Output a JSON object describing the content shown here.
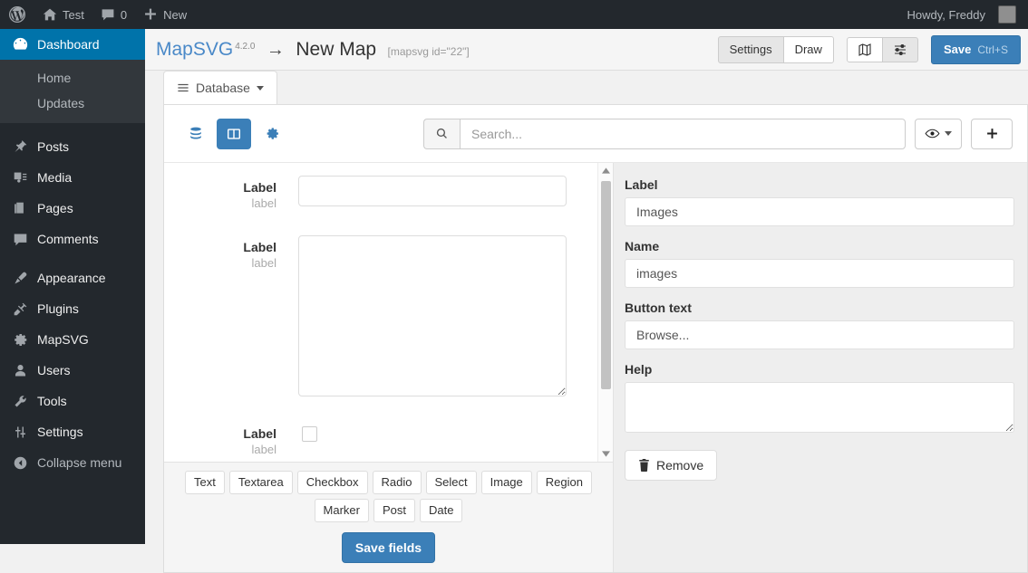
{
  "adminbar": {
    "logo_icon": "wordpress-logo-icon",
    "site_name": "Test",
    "site_icon": "home-icon",
    "comments_icon": "comment-bubble-icon",
    "comments_count": "0",
    "new_icon": "plus-icon",
    "new_label": "New",
    "howdy": "Howdy, Freddy",
    "avatar_icon": "avatar"
  },
  "sidebar": {
    "items": [
      {
        "label": "Dashboard",
        "icon": "dashboard-icon",
        "current": true
      },
      {
        "label": "Posts",
        "icon": "pin-icon",
        "current": false
      },
      {
        "label": "Media",
        "icon": "media-icon",
        "current": false
      },
      {
        "label": "Pages",
        "icon": "pages-icon",
        "current": false
      },
      {
        "label": "Comments",
        "icon": "comment-bubble-icon",
        "current": false
      },
      {
        "label": "Appearance",
        "icon": "paintbrush-icon",
        "current": false
      },
      {
        "label": "Plugins",
        "icon": "plug-icon",
        "current": false
      },
      {
        "label": "MapSVG",
        "icon": "gear-icon",
        "current": false
      },
      {
        "label": "Users",
        "icon": "user-icon",
        "current": false
      },
      {
        "label": "Tools",
        "icon": "wrench-icon",
        "current": false
      },
      {
        "label": "Settings",
        "icon": "sliders-icon",
        "current": false
      }
    ],
    "submenu": [
      {
        "label": "Home"
      },
      {
        "label": "Updates"
      }
    ],
    "collapse": {
      "label": "Collapse menu",
      "icon": "collapse-arrow-icon"
    }
  },
  "header": {
    "brand": "MapSVG",
    "version": "4.2.0",
    "arrow": "→",
    "map_title": "New Map",
    "shortcode": "[mapsvg id=\"22\"]",
    "mode_buttons": [
      {
        "label": "Settings",
        "active": true
      },
      {
        "label": "Draw",
        "active": false
      }
    ],
    "view_buttons": [
      {
        "icon": "map-icon",
        "active": false
      },
      {
        "icon": "sliders-icon",
        "active": true
      }
    ],
    "save": {
      "label": "Save",
      "shortcut": "Ctrl+S"
    },
    "accent_color": "#3b7fb8"
  },
  "tabs": [
    {
      "label": "Database",
      "icon": "hamburger-icon",
      "caret": true,
      "active": true
    }
  ],
  "toolbar": {
    "icons": [
      {
        "name": "database-icon",
        "active": false
      },
      {
        "name": "columns-icon",
        "active": true
      },
      {
        "name": "gear-icon",
        "active": false
      }
    ],
    "search": {
      "icon": "search-icon",
      "placeholder": "Search...",
      "value": ""
    },
    "visibility": {
      "icon": "eye-icon",
      "caret": true
    },
    "add": {
      "icon": "plus-icon"
    }
  },
  "form_preview": {
    "rows": [
      {
        "label": "Label",
        "sublabel": "label",
        "type": "text",
        "value": ""
      },
      {
        "label": "Label",
        "sublabel": "label",
        "type": "textarea",
        "value": ""
      },
      {
        "label": "Label",
        "sublabel": "label",
        "type": "checkbox",
        "checked": false
      }
    ],
    "field_type_buttons": [
      "Text",
      "Textarea",
      "Checkbox",
      "Radio",
      "Select",
      "Image",
      "Region",
      "Marker",
      "Post",
      "Date"
    ],
    "save_fields_label": "Save fields"
  },
  "properties": {
    "label": {
      "title": "Label",
      "value": "Images"
    },
    "name": {
      "title": "Name",
      "value": "images"
    },
    "button_text": {
      "title": "Button text",
      "value": "Browse..."
    },
    "help": {
      "title": "Help",
      "value": ""
    },
    "remove": {
      "label": "Remove",
      "icon": "trash-icon"
    }
  }
}
